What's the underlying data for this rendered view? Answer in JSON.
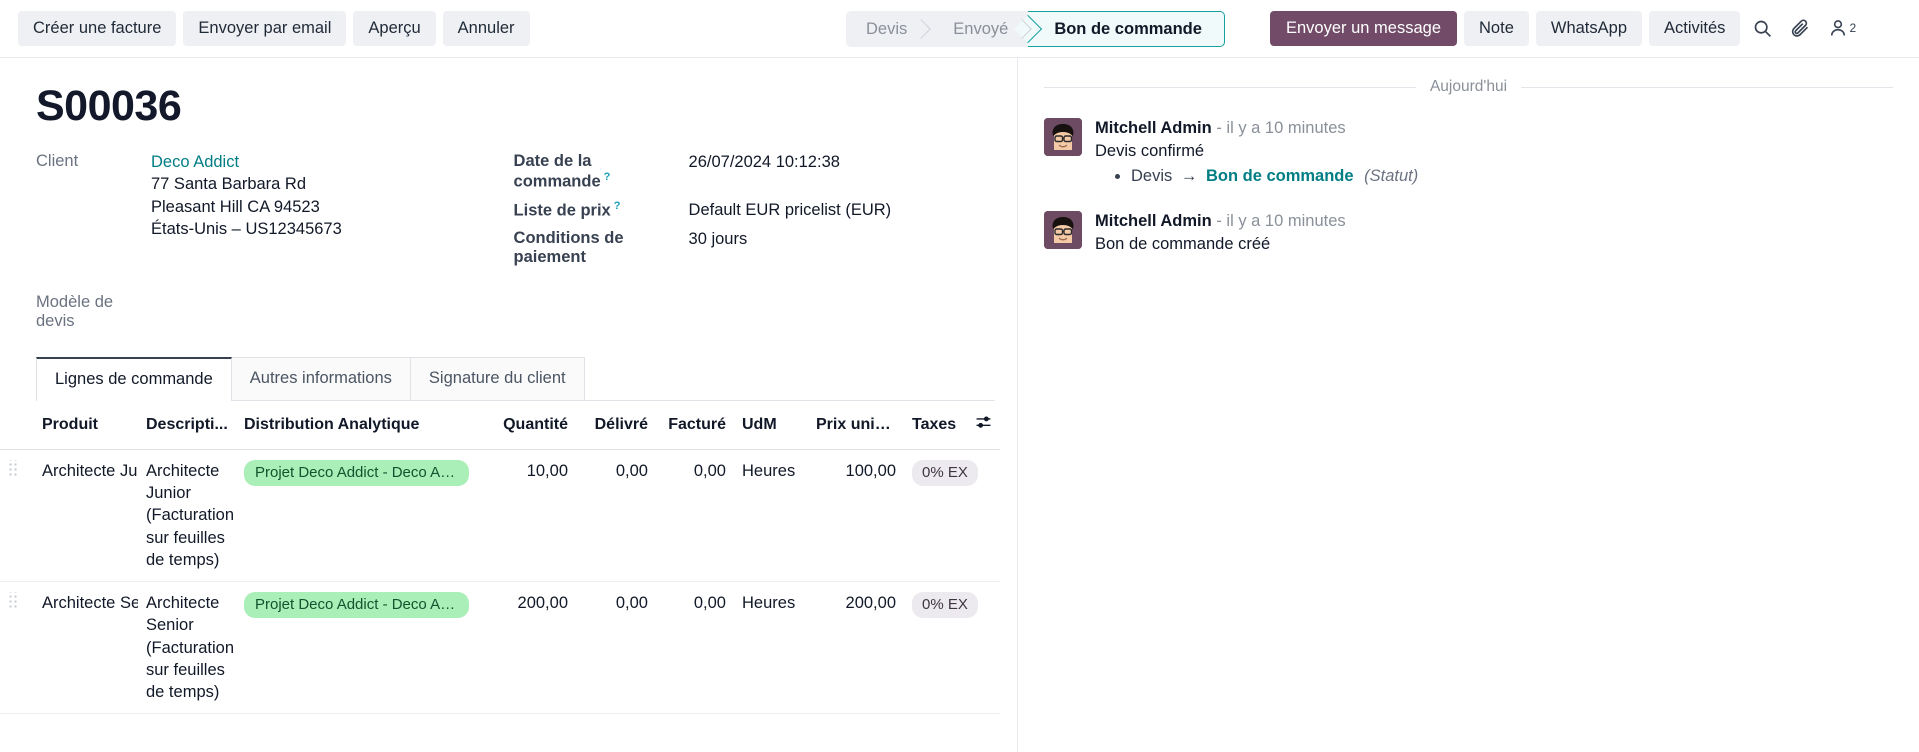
{
  "toolbar": {
    "buttons": [
      {
        "label": "Créer une facture",
        "name": "create-invoice-button"
      },
      {
        "label": "Envoyer par email",
        "name": "send-by-email-button"
      },
      {
        "label": "Aperçu",
        "name": "preview-button"
      },
      {
        "label": "Annuler",
        "name": "cancel-button"
      }
    ]
  },
  "statusbar": {
    "steps": [
      {
        "label": "Devis",
        "active": false
      },
      {
        "label": "Envoyé",
        "active": false
      },
      {
        "label": "Bon de commande",
        "active": true
      }
    ]
  },
  "chatter_actions": {
    "send_message": "Envoyer un message",
    "log_note": "Note",
    "whatsapp": "WhatsApp",
    "activities": "Activités",
    "follower_count": "2"
  },
  "record": {
    "title": "S00036",
    "customer_label": "Client",
    "customer_name": "Deco Addict",
    "address_lines": [
      "77 Santa Barbara Rd",
      "Pleasant Hill CA 94523",
      "États-Unis – US12345673"
    ],
    "quotation_template_label": "Modèle de devis",
    "quotation_template_value": "",
    "order_date_label": "Date de la commande",
    "order_date_value": "26/07/2024 10:12:38",
    "pricelist_label": "Liste de prix",
    "pricelist_value": "Default EUR pricelist (EUR)",
    "payment_terms_label": "Conditions de paiement",
    "payment_terms_value": "30 jours",
    "help_marker": "?"
  },
  "tabs": [
    {
      "label": "Lignes de commande",
      "active": true
    },
    {
      "label": "Autres informations",
      "active": false
    },
    {
      "label": "Signature du client",
      "active": false
    }
  ],
  "lines_table": {
    "headers": {
      "product": "Produit",
      "description": "Descripti...",
      "analytic": "Distribution Analytique",
      "quantity": "Quantité",
      "delivered": "Délivré",
      "invoiced": "Facturé",
      "uom": "UdM",
      "unit_price": "Prix unita...",
      "taxes": "Taxes"
    },
    "rows": [
      {
        "product": "Architecte Jur",
        "description": "Architecte Junior (Facturation sur feuilles de temps)",
        "analytic": "Projet Deco Addict - Deco Add...",
        "quantity": "10,00",
        "delivered": "0,00",
        "invoiced": "0,00",
        "uom": "Heures",
        "unit_price": "100,00",
        "taxes": "0% EX"
      },
      {
        "product": "Architecte Ser",
        "description": "Architecte Senior (Facturation sur feuilles de temps)",
        "analytic": "Projet Deco Addict - Deco Add...",
        "quantity": "200,00",
        "delivered": "0,00",
        "invoiced": "0,00",
        "uom": "Heures",
        "unit_price": "200,00",
        "taxes": "0% EX"
      }
    ]
  },
  "chatter": {
    "day_separator": "Aujourd'hui",
    "messages": [
      {
        "author": "Mitchell Admin",
        "time": "- il y a 10 minutes",
        "body": "Devis confirmé",
        "tracking": {
          "old_value": "Devis",
          "arrow": "→",
          "new_value": "Bon de commande",
          "field": "(Statut)"
        }
      },
      {
        "author": "Mitchell Admin",
        "time": "- il y a 10 minutes",
        "body": "Bon de commande créé",
        "tracking": null
      }
    ]
  },
  "colors": {
    "accent_teal": "#017e84",
    "brand_purple": "#714b67",
    "status_active_border": "#16a0a0",
    "analytic_pill": "#aaeeb8"
  }
}
